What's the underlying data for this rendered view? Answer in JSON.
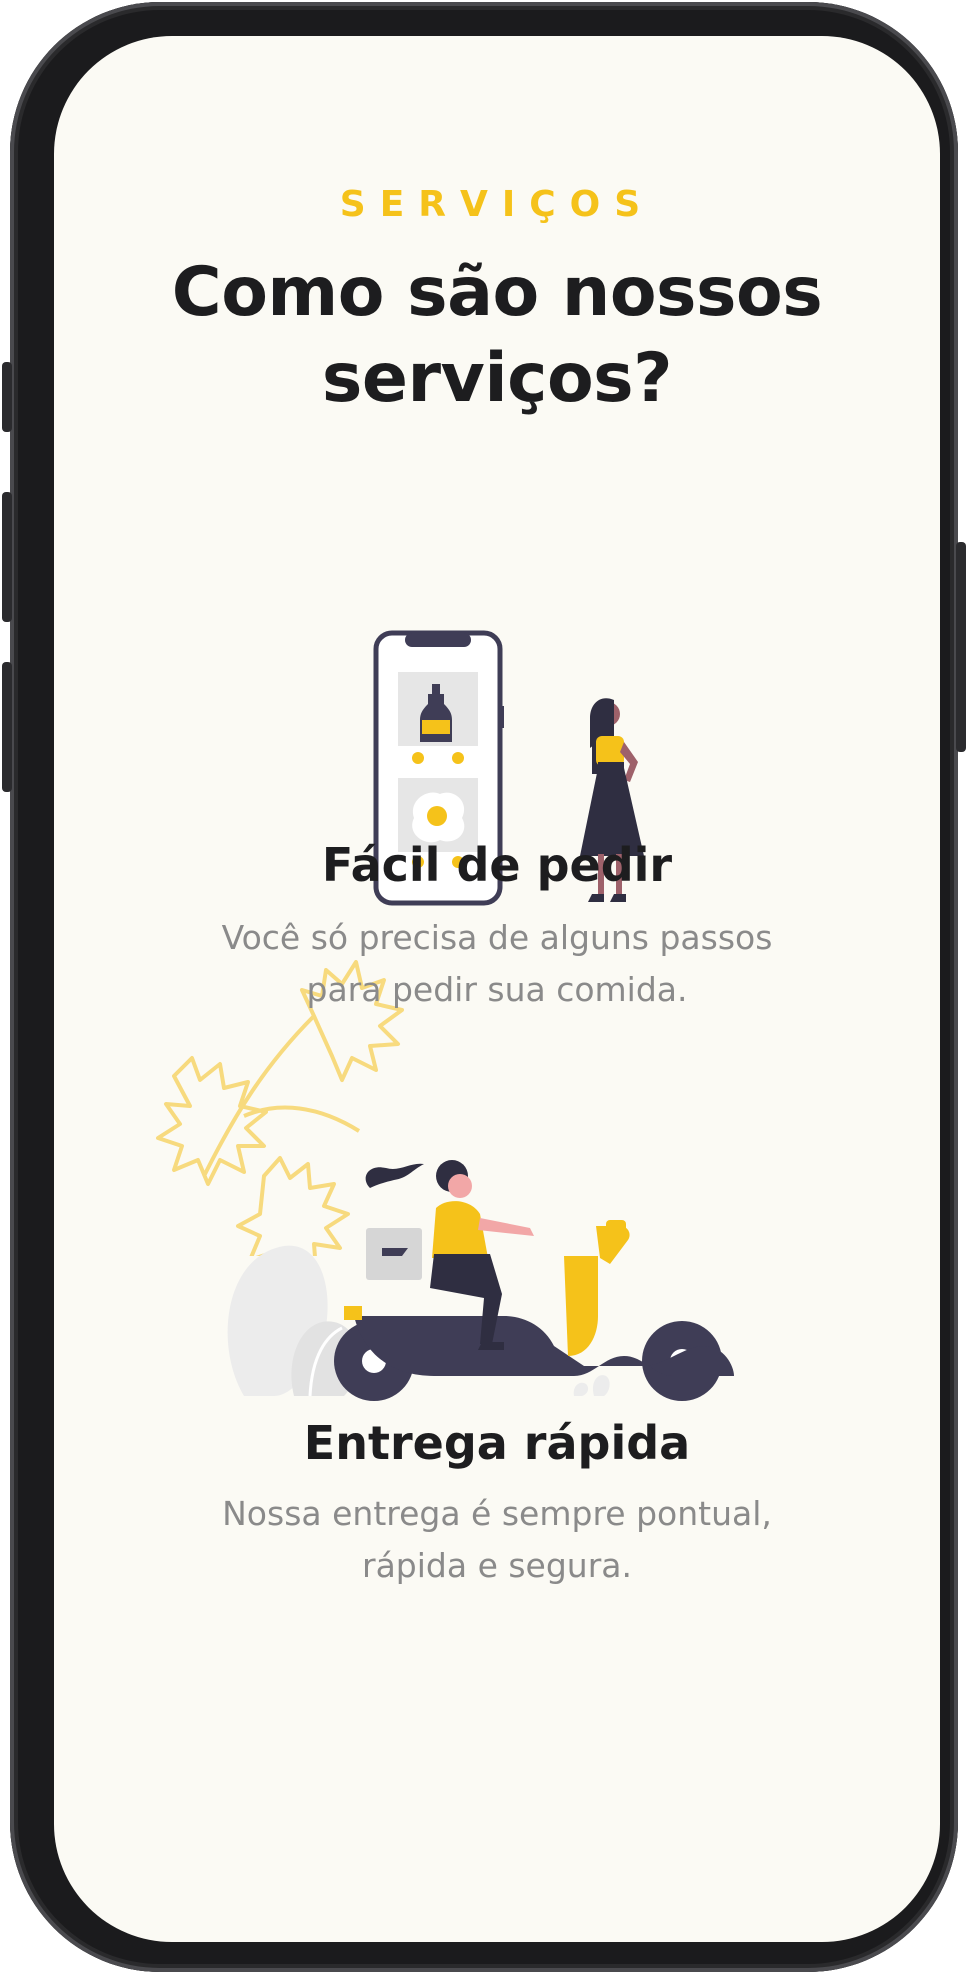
{
  "section": {
    "eyebrow": "SERVIÇOS",
    "title": "Como são nossos serviços?"
  },
  "services": [
    {
      "illustration": "phone-order-illustration",
      "title": "Fácil de pedir",
      "text": "Você só precisa de alguns passos para pedir sua comida."
    },
    {
      "illustration": "scooter-delivery-illustration",
      "title": "Entrega rápida",
      "text": "Nossa entrega é sempre pontual, rápida e segura."
    }
  ],
  "colors": {
    "accent": "#f5c21a",
    "dark": "#3f3d56",
    "background": "#fbfaf4",
    "text_muted": "#8a8a8a",
    "heading": "#1d1d1f"
  }
}
